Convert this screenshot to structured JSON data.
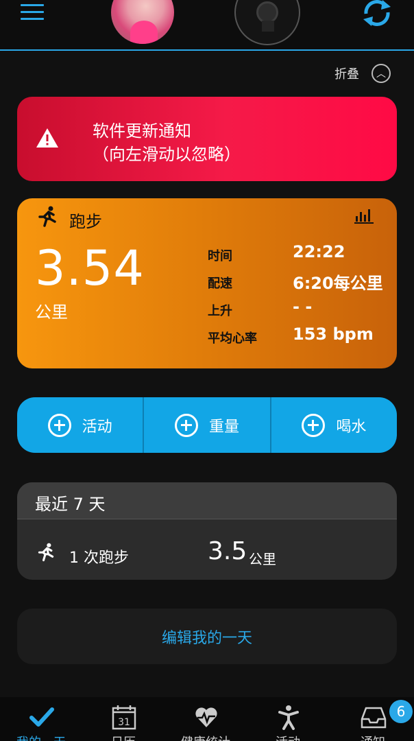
{
  "colors": {
    "accent": "#2aa8e8",
    "notice": "#f51a48",
    "run_card": "#f7960e",
    "actions": "#12a6e6"
  },
  "header": {
    "menu_icon": "hamburger-icon",
    "sync_icon": "sync-icon"
  },
  "collapse": {
    "label": "折叠"
  },
  "notice": {
    "line1": "软件更新通知",
    "line2": "（向左滑动以忽略）"
  },
  "run_card": {
    "title": "跑步",
    "distance": "3.54",
    "unit": "公里",
    "stats": [
      {
        "label": "时间",
        "value": "22:22"
      },
      {
        "label": "配速",
        "value": "6:20每公里"
      },
      {
        "label": "上升",
        "value": "- -"
      },
      {
        "label": "平均心率",
        "value": "153 bpm"
      }
    ]
  },
  "actions": [
    {
      "label": "活动"
    },
    {
      "label": "重量"
    },
    {
      "label": "喝水"
    }
  ],
  "recent": {
    "title": "最近 7 天",
    "count": "1 次跑步",
    "distance": "3.5",
    "unit": "公里"
  },
  "edit": {
    "label": "编辑我的一天"
  },
  "bottom_nav": {
    "items": [
      {
        "label": "我的一天",
        "icon": "check-icon"
      },
      {
        "label": "日历",
        "icon": "calendar-icon",
        "day": "31"
      },
      {
        "label": "健康统计",
        "icon": "heart-rate-icon"
      },
      {
        "label": "活动",
        "icon": "person-icon"
      },
      {
        "label": "通知",
        "icon": "inbox-icon"
      }
    ],
    "badge": "6"
  }
}
